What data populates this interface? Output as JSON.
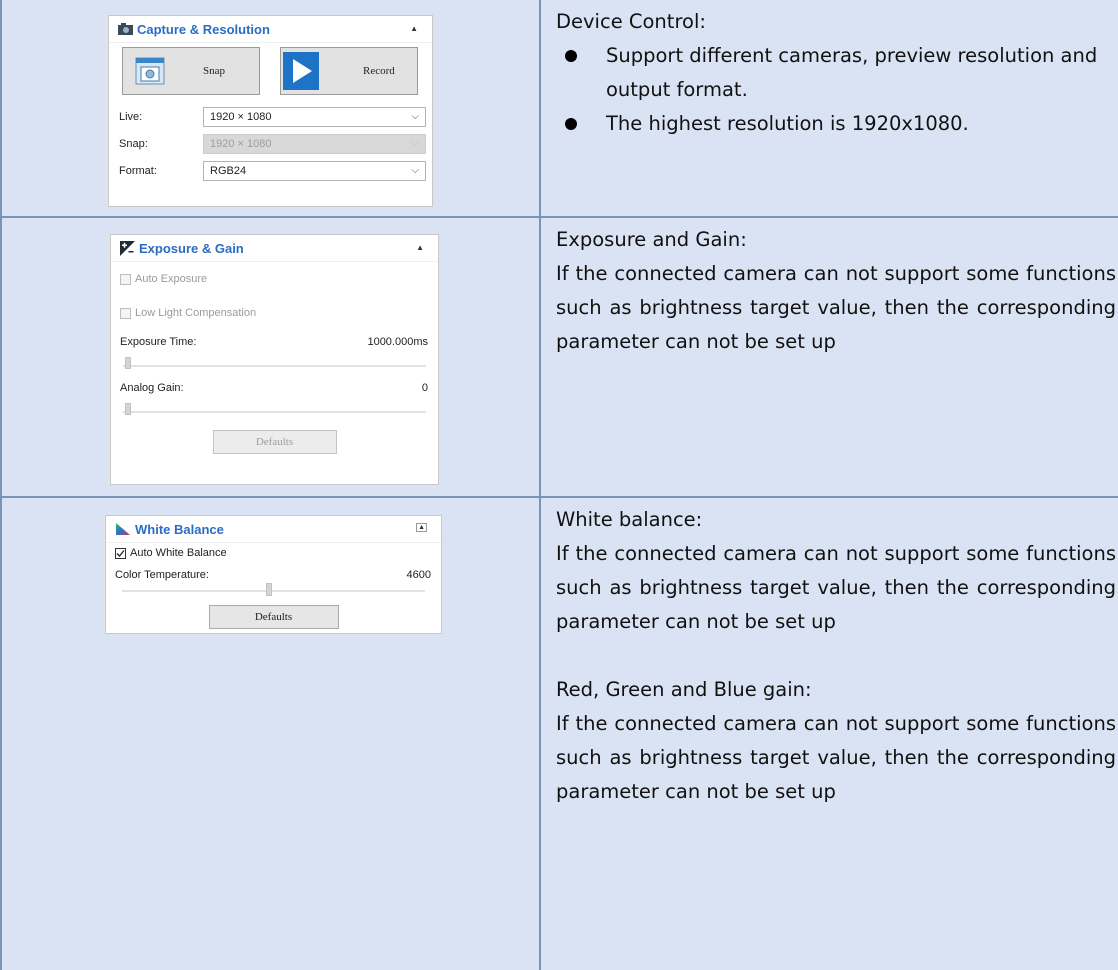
{
  "capture": {
    "title": "Capture & Resolution",
    "snap_label": "Snap",
    "record_label": "Record",
    "live_label": "Live:",
    "live_value": "1920 × 1080",
    "snap_res_label": "Snap:",
    "snap_res_value": "1920 × 1080",
    "format_label": "Format:",
    "format_value": "RGB24"
  },
  "exposure": {
    "title": "Exposure & Gain",
    "auto_exposure_label": "Auto Exposure",
    "auto_exposure_checked": false,
    "low_light_label": "Low Light Compensation",
    "low_light_checked": false,
    "exposure_time_label": "Exposure Time:",
    "exposure_time_value": "1000.000ms",
    "analog_gain_label": "Analog Gain:",
    "analog_gain_value": "0",
    "defaults_label": "Defaults"
  },
  "white_balance": {
    "title": "White Balance",
    "auto_wb_label": "Auto White Balance",
    "auto_wb_checked": true,
    "color_temp_label": "Color Temperature:",
    "color_temp_value": "4600",
    "defaults_label": "Defaults"
  },
  "descriptions": {
    "device": {
      "title": "Device Control:",
      "bullets": [
        "Support different cameras, preview resolution and output format.",
        "The highest resolution is 1920x1080."
      ]
    },
    "exposure": {
      "title": "Exposure and Gain:",
      "body": "If the connected camera can not support some functions such as brightness target value, then the corresponding parameter can not be set up"
    },
    "white_balance": {
      "title": "White balance:",
      "body": "If the connected camera can not support some functions such as brightness target value, then the corresponding parameter can not be set up"
    },
    "rgb_gain": {
      "title": "Red, Green and Blue gain:",
      "body": "If the connected camera can not support some functions such as brightness target value, then the corresponding parameter can not be set up"
    }
  },
  "colors": {
    "table_bg": "#dae3f3",
    "table_border": "#7a93b8",
    "panel_title": "#2b6cc4"
  }
}
